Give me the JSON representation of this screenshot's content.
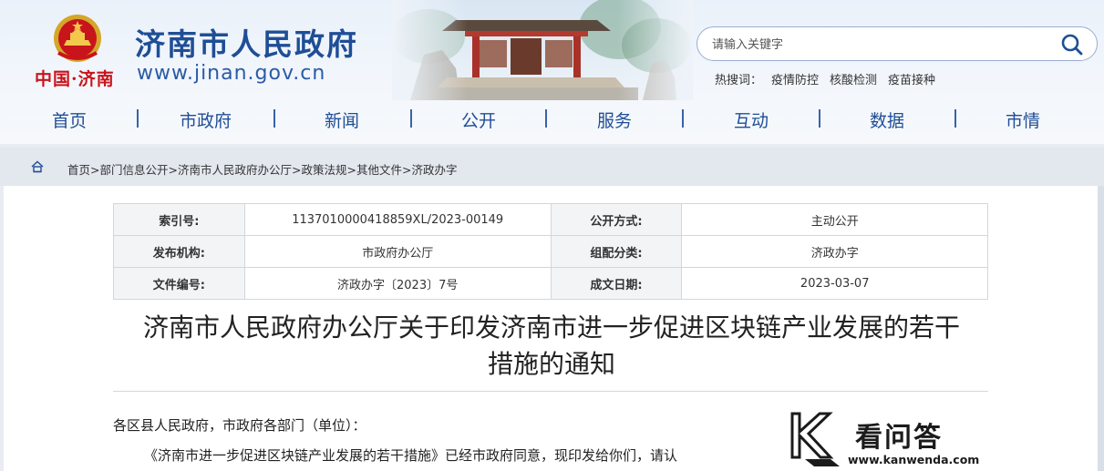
{
  "header": {
    "site_title": "济南市人民政府",
    "site_url": "www.jinan.gov.cn",
    "city_seal": "中国·济南",
    "search": {
      "placeholder": "请输入关键字",
      "icon": "search-icon"
    },
    "hotwords": {
      "label": "热搜词：",
      "items": [
        "疫情防控",
        "核酸检测",
        "疫苗接种"
      ]
    }
  },
  "nav": {
    "items": [
      "首页",
      "市政府",
      "新闻",
      "公开",
      "服务",
      "互动",
      "数据",
      "市情"
    ]
  },
  "breadcrumb": {
    "icon": "home-icon",
    "items": [
      "首页",
      "部门信息公开",
      "济南市人民政府办公厅",
      "政策法规",
      "其他文件",
      "济政办字"
    ],
    "separator": ">"
  },
  "meta": {
    "rows": [
      {
        "label1": "索引号:",
        "value1": "1137010000418859XL/2023-00149",
        "label2": "公开方式:",
        "value2": "主动公开"
      },
      {
        "label1": "发布机构:",
        "value1": "市政府办公厅",
        "label2": "组配分类:",
        "value2": "济政办字"
      },
      {
        "label1": "文件编号:",
        "value1": "济政办字〔2023〕7号",
        "label2": "成文日期:",
        "value2": "2023-03-07"
      }
    ]
  },
  "document": {
    "title_line1": "济南市人民政府办公厅关于印发济南市进一步促进区块链产业发展的若干",
    "title_line2": "措施的通知",
    "salutation": "各区县人民政府，市政府各部门（单位）：",
    "body_line1": "《济南市进一步促进区块链产业发展的若干措施》已经市政府同意，现印发给你们，请认"
  },
  "watermark": {
    "cn_text": "看问答",
    "url": "www.kanwenda.com"
  },
  "colors": {
    "brand_blue": "#1f4e96",
    "seal_red": "#c8141b",
    "page_bg": "#e9edf3"
  }
}
